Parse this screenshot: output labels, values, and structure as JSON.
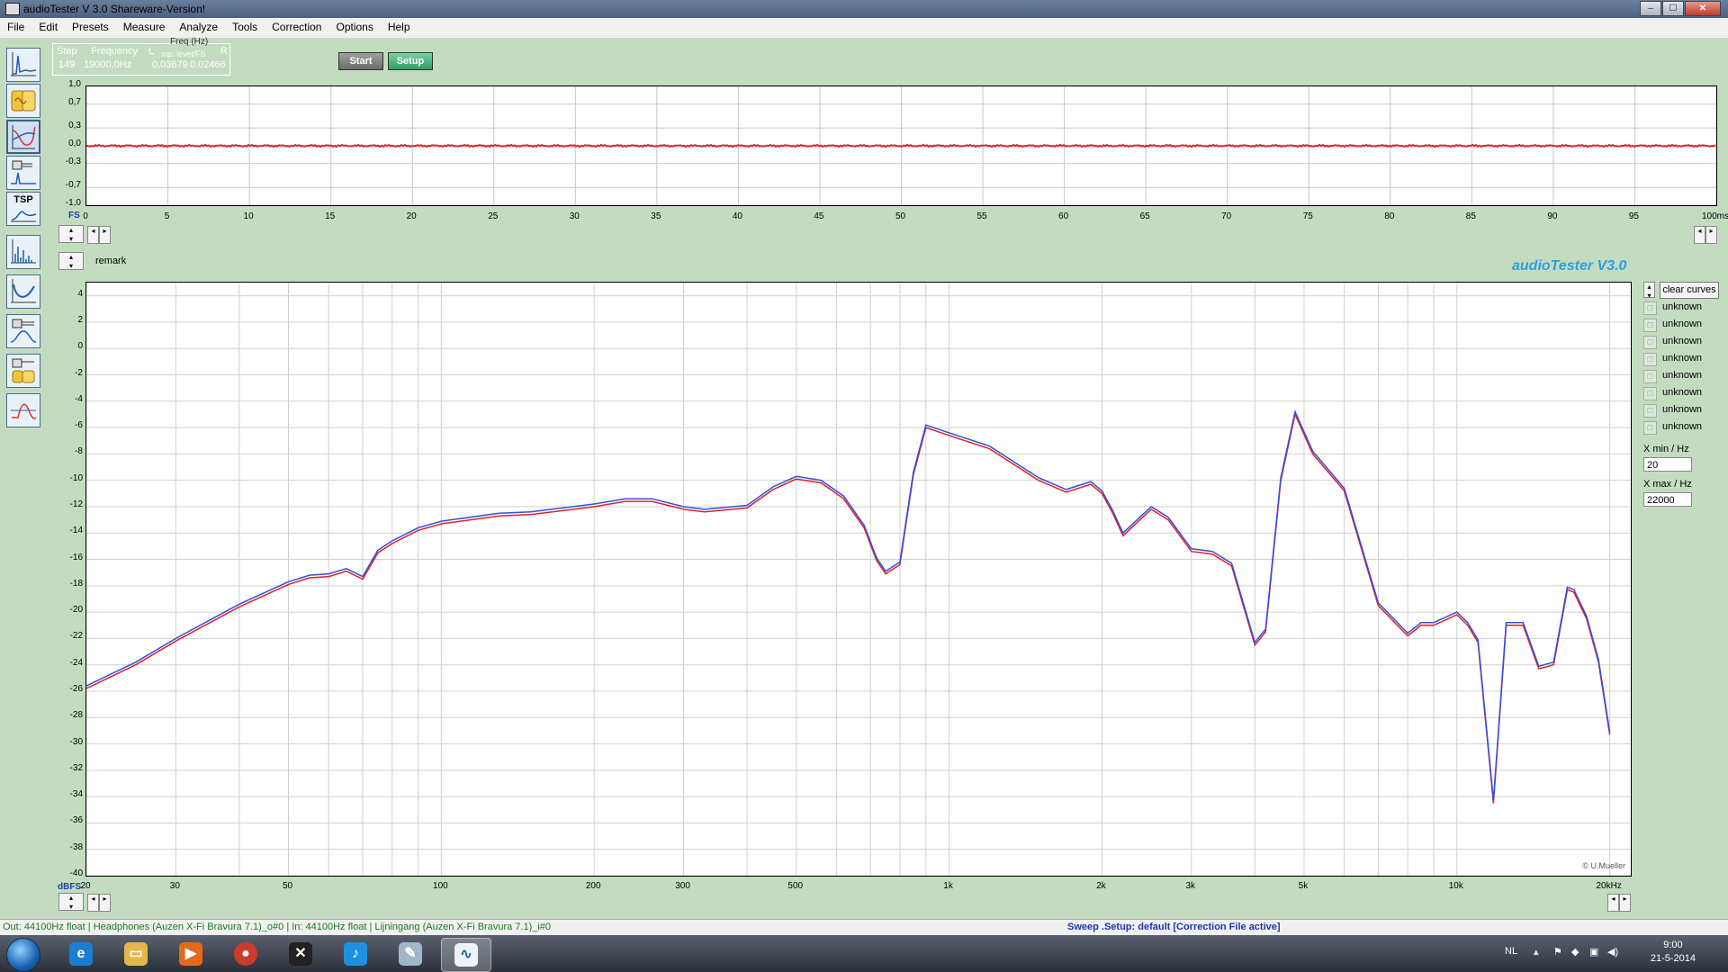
{
  "window": {
    "title": "audioTester  V 3.0 Shareware-Version!",
    "buttons": [
      "–",
      "☐",
      "✕"
    ]
  },
  "menu": [
    "File",
    "Edit",
    "Presets",
    "Measure",
    "Analyze",
    "Tools",
    "Correction",
    "Options",
    "Help"
  ],
  "left_tools": [
    {
      "name": "scope-tool",
      "active": false,
      "label": ""
    },
    {
      "name": "generator-tool",
      "active": false,
      "label": ""
    },
    {
      "name": "sweep-tool",
      "active": true,
      "label": ""
    },
    {
      "name": "impulse-tool",
      "active": false,
      "label": ""
    },
    {
      "name": "tsp-tool",
      "active": false,
      "label": "TSP"
    },
    {
      "name": "spectrum-tool",
      "active": false,
      "label": ""
    },
    {
      "name": "distortion-tool",
      "active": false,
      "label": ""
    },
    {
      "name": "filter-tool",
      "active": false,
      "label": ""
    },
    {
      "name": "level-tool",
      "active": false,
      "label": ""
    },
    {
      "name": "phase-tool",
      "active": false,
      "label": ""
    }
  ],
  "info_panel": {
    "headers": [
      "Step",
      "Frequency",
      "L",
      "inp. level/FS",
      "R"
    ],
    "values": [
      "149",
      "19000,0Hz",
      "0,03679",
      "0,02466"
    ],
    "overlay": "Freq (Hz)"
  },
  "buttons": {
    "start": "Start",
    "setup": "Setup"
  },
  "top_plot": {
    "y_ticks": [
      "1,0",
      "0,7",
      "0,3",
      "0,0",
      "-0,3",
      "-0,7",
      "-1,0"
    ],
    "x_ticks": [
      "0",
      "5",
      "10",
      "15",
      "20",
      "25",
      "30",
      "35",
      "40",
      "45",
      "50",
      "55",
      "60",
      "65",
      "70",
      "75",
      "80",
      "85",
      "90",
      "95",
      "100ms"
    ],
    "y_unit": "FS"
  },
  "remark": "remark",
  "brand": "audioTester  V3.0",
  "copyright": "© U.Mueller",
  "legend": {
    "clear_label": "clear curves",
    "curves": [
      "unknown",
      "unknown",
      "unknown",
      "unknown",
      "unknown",
      "unknown",
      "unknown",
      "unknown"
    ]
  },
  "axis_fields": {
    "xmin_label": "X min / Hz",
    "xmin_value": "20",
    "xmax_label": "X max / Hz",
    "xmax_value": "22000"
  },
  "status": {
    "left": "Out: 44100Hz float  | Headphones (Auzen X-Fi Bravura 7.1)_o#0  | In: 44100Hz float  | Lijningang (Auzen X-Fi Bravura 7.1)_i#0",
    "right": "Sweep  .Setup:  default  [Correction File active]"
  },
  "taskbar": {
    "apps": [
      "ie-icon",
      "explorer-icon",
      "media-player-icon",
      "chrome-icon",
      "app-x-icon",
      "itunes-icon",
      "notepad-icon",
      "audiotester-icon"
    ],
    "lang": "NL",
    "time": "9:00",
    "date": "21-5-2014"
  },
  "colors": {
    "curve_red": "#e0202a",
    "curve_blue": "#3050e0",
    "bg": "#c3dcc0",
    "brand": "#2e9ee0"
  },
  "chart_data": [
    {
      "type": "line",
      "title": "",
      "xlabel": "",
      "ylabel": "FS",
      "xlim": [
        0,
        100
      ],
      "ylim": [
        -1.0,
        1.0
      ],
      "x_tick_labels": [
        "0",
        "5",
        "10",
        "15",
        "20",
        "25",
        "30",
        "35",
        "40",
        "45",
        "50",
        "55",
        "60",
        "65",
        "70",
        "75",
        "80",
        "85",
        "90",
        "95",
        "100ms"
      ],
      "y_tick_labels": [
        "1,0",
        "0,7",
        "0,3",
        "0,0",
        "-0,3",
        "-0,7",
        "-1,0"
      ],
      "series": [
        {
          "values": [
            0,
            0
          ],
          "x": [
            0,
            100
          ]
        }
      ]
    },
    {
      "type": "line",
      "title": "",
      "xlabel": "",
      "ylabel": "dBFS",
      "x_scale": "log",
      "xlim": [
        20,
        22000
      ],
      "ylim": [
        -40,
        5
      ],
      "x_tick_labels": [
        "20",
        "30",
        "50",
        "100",
        "200",
        "300",
        "500",
        "1k",
        "2k",
        "3k",
        "5k",
        "10k",
        "20kHz"
      ],
      "x_tick_values": [
        20,
        30,
        50,
        100,
        200,
        300,
        500,
        1000,
        2000,
        3000,
        5000,
        10000,
        20000
      ],
      "y_tick_labels": [
        "4",
        "2",
        "0",
        "-2",
        "-4",
        "-6",
        "-8",
        "-10",
        "-12",
        "-14",
        "-16",
        "-18",
        "-20",
        "-22",
        "-24",
        "-26",
        "-28",
        "-30",
        "-32",
        "-34",
        "-36",
        "-38",
        "-40"
      ],
      "x": [
        20,
        25,
        30,
        40,
        50,
        55,
        60,
        65,
        70,
        75,
        80,
        90,
        100,
        130,
        150,
        200,
        230,
        260,
        300,
        330,
        400,
        450,
        500,
        560,
        620,
        680,
        720,
        750,
        800,
        850,
        900,
        1000,
        1200,
        1500,
        1700,
        1900,
        2000,
        2100,
        2200,
        2500,
        2700,
        3000,
        3300,
        3600,
        4000,
        4200,
        4500,
        4800,
        5200,
        6000,
        7000,
        8000,
        8500,
        9000,
        10000,
        10500,
        11000,
        11800,
        12500,
        13500,
        14500,
        15500,
        16500,
        17000,
        18000,
        19000,
        20000
      ],
      "series": [
        {
          "values": [
            -25.8,
            -24.0,
            -22.2,
            -19.6,
            -17.9,
            -17.4,
            -17.3,
            -16.9,
            -17.5,
            -15.5,
            -14.8,
            -13.8,
            -13.3,
            -12.7,
            -12.6,
            -12.0,
            -11.6,
            -11.6,
            -12.2,
            -12.4,
            -12.1,
            -10.7,
            -9.9,
            -10.2,
            -11.4,
            -13.6,
            -16.1,
            -17.1,
            -16.4,
            -9.6,
            -6.0,
            -6.6,
            -7.6,
            -10.0,
            -10.9,
            -10.3,
            -11.0,
            -12.5,
            -14.2,
            -12.2,
            -13.0,
            -15.4,
            -15.6,
            -16.5,
            -22.5,
            -21.5,
            -10.0,
            -5.0,
            -8.0,
            -10.8,
            -19.5,
            -21.8,
            -21.0,
            -21.0,
            -20.2,
            -21.0,
            -22.3,
            -34.5,
            -21.0,
            -21.0,
            -24.3,
            -24.0,
            -18.3,
            -18.5,
            -20.5,
            -23.8,
            -29.3
          ]
        },
        {
          "values": [
            -25.6,
            -23.8,
            -22.0,
            -19.4,
            -17.7,
            -17.2,
            -17.1,
            -16.7,
            -17.3,
            -15.3,
            -14.6,
            -13.6,
            -13.1,
            -12.5,
            -12.4,
            -11.8,
            -11.4,
            -11.4,
            -12.0,
            -12.2,
            -11.9,
            -10.5,
            -9.7,
            -10.0,
            -11.2,
            -13.4,
            -15.9,
            -16.9,
            -16.2,
            -9.4,
            -5.8,
            -6.4,
            -7.4,
            -9.8,
            -10.7,
            -10.1,
            -10.8,
            -12.3,
            -14.0,
            -12.0,
            -12.8,
            -15.2,
            -15.4,
            -16.3,
            -22.3,
            -21.3,
            -9.8,
            -4.8,
            -7.8,
            -10.6,
            -19.3,
            -21.6,
            -20.8,
            -20.8,
            -20.0,
            -20.8,
            -22.1,
            -34.3,
            -20.8,
            -20.8,
            -24.1,
            -23.8,
            -18.1,
            -18.3,
            -20.3,
            -23.6,
            -29.1
          ]
        }
      ]
    }
  ]
}
